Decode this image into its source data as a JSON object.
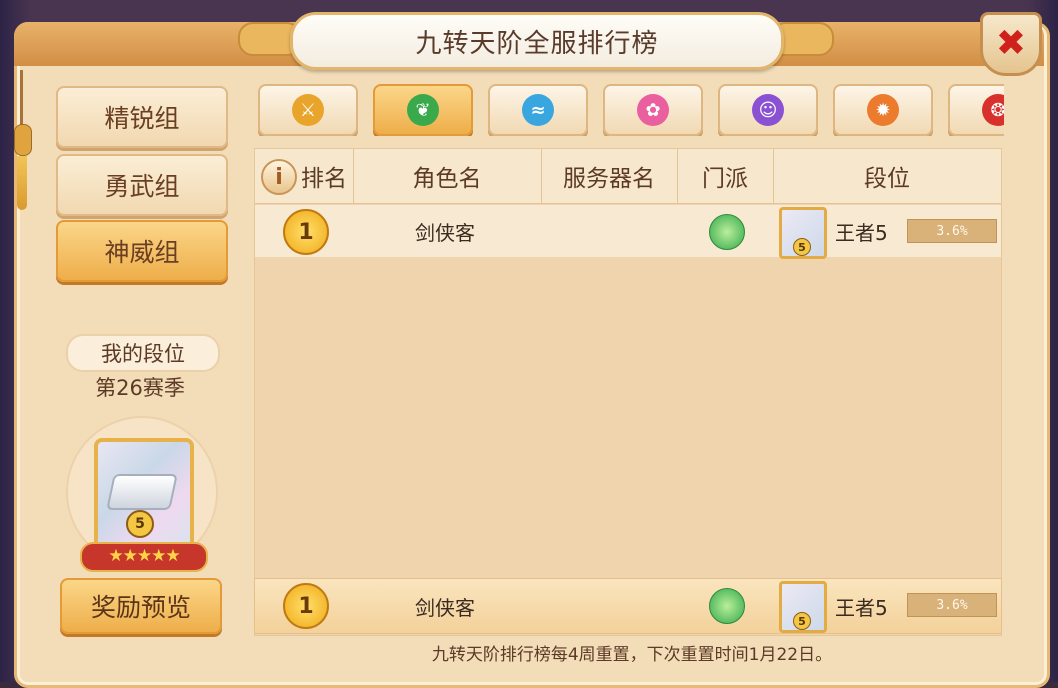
{
  "window": {
    "title": "九转天阶全服排行榜"
  },
  "left_panel": {
    "groups": [
      {
        "label": "精锐组",
        "active": false
      },
      {
        "label": "勇武组",
        "active": false
      },
      {
        "label": "神威组",
        "active": true
      }
    ],
    "my_rank_label": "我的段位",
    "season_label": "第26赛季",
    "badge": {
      "level": "5",
      "stars": "★★★★★"
    },
    "reward_button": "奖励预览"
  },
  "tabs": [
    {
      "icon": "sword-sect-icon",
      "color": "#e9a52b",
      "active": false
    },
    {
      "icon": "leaf-sect-icon",
      "color": "#39a94c",
      "active": true
    },
    {
      "icon": "water-sect-icon",
      "color": "#3aa6e0",
      "active": false
    },
    {
      "icon": "lotus-sect-icon",
      "color": "#ea5f9d",
      "active": false
    },
    {
      "icon": "ghost-sect-icon",
      "color": "#8a52d3",
      "active": false
    },
    {
      "icon": "flame-sect-icon",
      "color": "#ec7b2e",
      "active": false
    },
    {
      "icon": "demon-sect-icon",
      "color": "#d8312c",
      "active": false
    }
  ],
  "table": {
    "headers": {
      "rank": "排名",
      "role": "角色名",
      "server": "服务器名",
      "sect": "门派",
      "tier": "段位"
    },
    "rows": [
      {
        "rank": "1",
        "name": "剑侠客",
        "server": "",
        "sect_icon": "leaf-sect-icon",
        "tier_level": "5",
        "tier": "王者5",
        "progress": "3.6%"
      }
    ],
    "my_row": {
      "rank": "1",
      "name": "剑侠客",
      "server": "",
      "sect_icon": "leaf-sect-icon",
      "tier_level": "5",
      "tier": "王者5",
      "progress": "3.6%"
    }
  },
  "footer": "九转天阶排行榜每4周重置，下次重置时间1月22日。"
}
